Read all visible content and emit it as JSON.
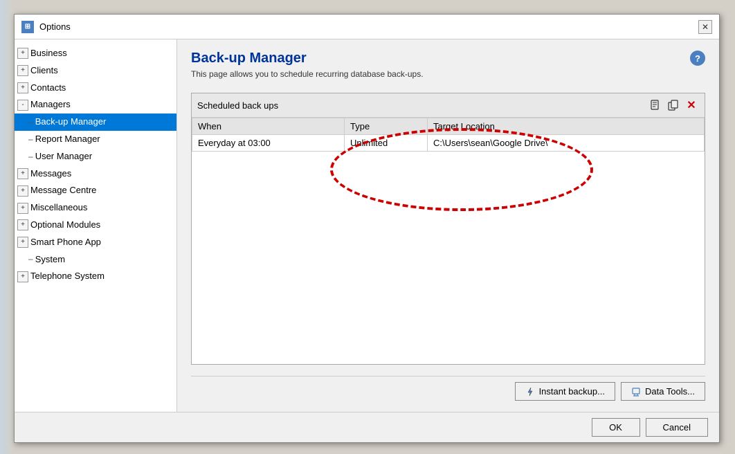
{
  "dialog": {
    "title": "Options",
    "icon": "⊞",
    "close_label": "✕"
  },
  "sidebar": {
    "items": [
      {
        "id": "business",
        "label": "Business",
        "level": 1,
        "type": "expandable",
        "symbol": "+"
      },
      {
        "id": "clients",
        "label": "Clients",
        "level": 1,
        "type": "expandable",
        "symbol": "+"
      },
      {
        "id": "contacts",
        "label": "Contacts",
        "level": 1,
        "type": "expandable",
        "symbol": "+"
      },
      {
        "id": "managers",
        "label": "Managers",
        "level": 1,
        "type": "expandable",
        "symbol": "-"
      },
      {
        "id": "backup-manager",
        "label": "Back-up Manager",
        "level": 2,
        "type": "leaf",
        "selected": true
      },
      {
        "id": "report-manager",
        "label": "Report Manager",
        "level": 2,
        "type": "leaf",
        "selected": false
      },
      {
        "id": "user-manager",
        "label": "User Manager",
        "level": 2,
        "type": "leaf",
        "selected": false
      },
      {
        "id": "messages",
        "label": "Messages",
        "level": 1,
        "type": "expandable",
        "symbol": "+"
      },
      {
        "id": "message-centre",
        "label": "Message Centre",
        "level": 1,
        "type": "expandable",
        "symbol": "+"
      },
      {
        "id": "miscellaneous",
        "label": "Miscellaneous",
        "level": 1,
        "type": "expandable",
        "symbol": "+"
      },
      {
        "id": "optional-modules",
        "label": "Optional Modules",
        "level": 1,
        "type": "expandable",
        "symbol": "+"
      },
      {
        "id": "smart-phone-app",
        "label": "Smart Phone App",
        "level": 1,
        "type": "expandable",
        "symbol": "+"
      },
      {
        "id": "system",
        "label": "System",
        "level": 2,
        "type": "leaf",
        "selected": false
      },
      {
        "id": "telephone-system",
        "label": "Telephone System",
        "level": 1,
        "type": "expandable",
        "symbol": "+"
      }
    ]
  },
  "content": {
    "title": "Back-up Manager",
    "subtitle": "This page allows you to schedule recurring database back-ups.",
    "help_label": "?",
    "scheduled_label": "Scheduled back ups",
    "table": {
      "columns": [
        "When",
        "Type",
        "Target Location"
      ],
      "rows": [
        {
          "when": "Everyday at 03:00",
          "type": "Unlimited",
          "target": "C:\\Users\\sean\\Google Drive\\"
        }
      ]
    },
    "toolbar": {
      "new_icon": "📄",
      "copy_icon": "📋",
      "delete_icon": "✕"
    },
    "buttons": {
      "instant_backup": "Instant backup...",
      "data_tools": "Data Tools...",
      "ok": "OK",
      "cancel": "Cancel"
    }
  }
}
